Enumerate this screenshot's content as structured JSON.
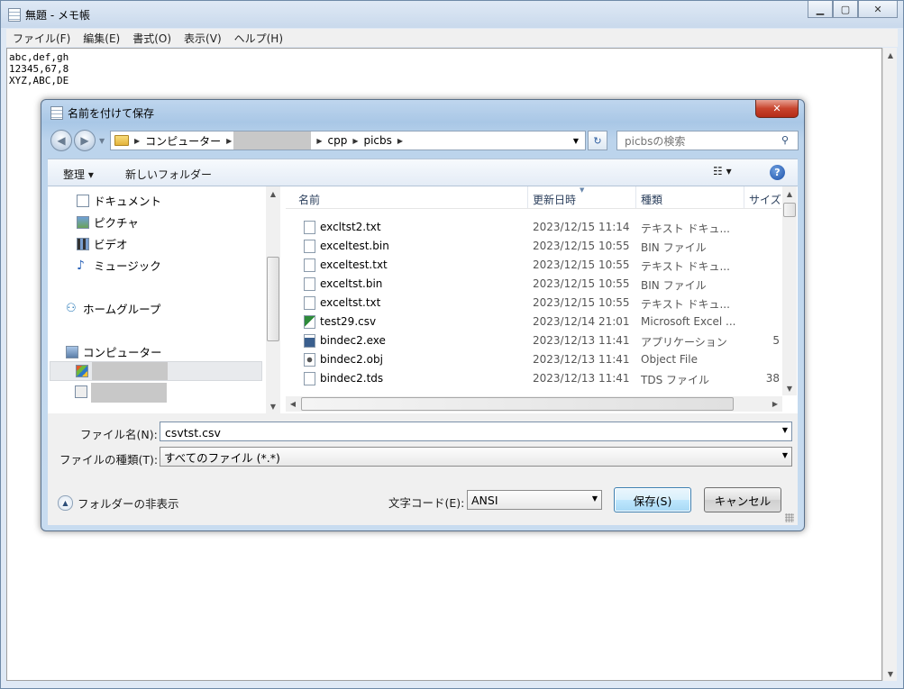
{
  "notepad": {
    "title": "無題 - メモ帳",
    "menu": [
      "ファイル(F)",
      "編集(E)",
      "書式(O)",
      "表示(V)",
      "ヘルプ(H)"
    ],
    "lines": [
      "abc,def,gh",
      "12345,67,8",
      "XYZ,ABC,DE"
    ]
  },
  "dialog": {
    "title": "名前を付けて保存",
    "breadcrumb": [
      "コンピューター",
      "",
      "cpp",
      "picbs"
    ],
    "search_placeholder": "picbsの検索",
    "organize": "整理 ▾",
    "new_folder": "新しいフォルダー",
    "view_menu": "☷ ▾",
    "help": "?",
    "tree": [
      "ドキュメント",
      "ピクチャ",
      "ビデオ",
      "ミュージック",
      "ホームグループ",
      "コンピューター"
    ],
    "columns": [
      "名前",
      "更新日時",
      "種類",
      "サイズ"
    ],
    "files": [
      {
        "name": "excltst2.txt",
        "date": "2023/12/15 11:14",
        "type": "テキスト ドキュ...",
        "size": ""
      },
      {
        "name": "exceltest.bin",
        "date": "2023/12/15 10:55",
        "type": "BIN ファイル",
        "size": ""
      },
      {
        "name": "exceltest.txt",
        "date": "2023/12/15 10:55",
        "type": "テキスト ドキュ...",
        "size": ""
      },
      {
        "name": "exceltst.bin",
        "date": "2023/12/15 10:55",
        "type": "BIN ファイル",
        "size": ""
      },
      {
        "name": "exceltst.txt",
        "date": "2023/12/15 10:55",
        "type": "テキスト ドキュ...",
        "size": ""
      },
      {
        "name": "test29.csv",
        "date": "2023/12/14 21:01",
        "type": "Microsoft Excel ...",
        "size": ""
      },
      {
        "name": "bindec2.exe",
        "date": "2023/12/13 11:41",
        "type": "アプリケーション",
        "size": "5"
      },
      {
        "name": "bindec2.obj",
        "date": "2023/12/13 11:41",
        "type": "Object File",
        "size": ""
      },
      {
        "name": "bindec2.tds",
        "date": "2023/12/13 11:41",
        "type": "TDS ファイル",
        "size": "38"
      }
    ],
    "filename_label": "ファイル名(N):",
    "filename_value": "csvtst.csv",
    "filetype_label": "ファイルの種類(T):",
    "filetype_value": "すべてのファイル (*.*)",
    "hide_folders": "フォルダーの非表示",
    "encoding_label": "文字コード(E):",
    "encoding_value": "ANSI",
    "save": "保存(S)",
    "cancel": "キャンセル"
  }
}
